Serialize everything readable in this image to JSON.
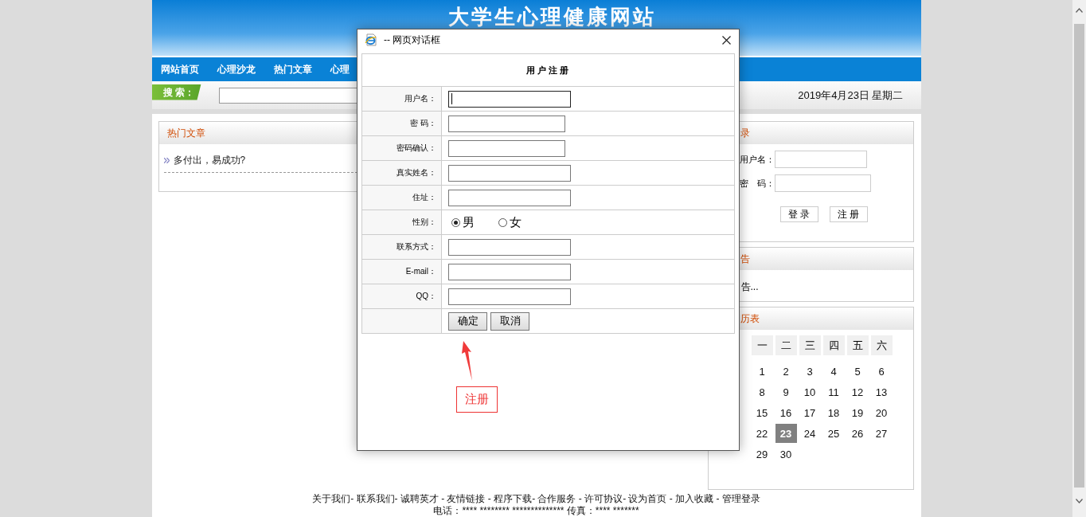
{
  "banner": {
    "title": "大学生心理健康网站"
  },
  "nav": [
    "网站首页",
    "心理沙龙",
    "热门文章",
    "心理"
  ],
  "search": {
    "label": "搜 索："
  },
  "date": "2019年4月23日 星期二",
  "hot_articles": {
    "title": "热门文章",
    "items": [
      "多付出，易成功?"
    ]
  },
  "login": {
    "title": "录",
    "fields": [
      "用户名：",
      "密　码："
    ],
    "buttons": [
      "登 录",
      "注 册"
    ]
  },
  "notice": {
    "title": "告",
    "text": "告..."
  },
  "calendar": {
    "title": "历表",
    "weekdays": [
      "一",
      "二",
      "三",
      "四",
      "五",
      "六"
    ],
    "weeks": [
      [
        {
          "day": "1",
          "selected": false
        },
        {
          "day": "2",
          "selected": false
        },
        {
          "day": "3",
          "selected": false
        },
        {
          "day": "4",
          "selected": false
        },
        {
          "day": "5",
          "selected": false
        },
        {
          "day": "6",
          "selected": false
        }
      ],
      [
        {
          "day": "8",
          "selected": false
        },
        {
          "day": "9",
          "selected": false
        },
        {
          "day": "10",
          "selected": false
        },
        {
          "day": "11",
          "selected": false
        },
        {
          "day": "12",
          "selected": false
        },
        {
          "day": "13",
          "selected": false
        }
      ],
      [
        {
          "day": "15",
          "selected": false
        },
        {
          "day": "16",
          "selected": false
        },
        {
          "day": "17",
          "selected": false
        },
        {
          "day": "18",
          "selected": false
        },
        {
          "day": "19",
          "selected": false
        },
        {
          "day": "20",
          "selected": false
        }
      ],
      [
        {
          "day": "22",
          "selected": false
        },
        {
          "day": "23",
          "selected": true
        },
        {
          "day": "24",
          "selected": false
        },
        {
          "day": "25",
          "selected": false
        },
        {
          "day": "26",
          "selected": false
        },
        {
          "day": "27",
          "selected": false
        }
      ],
      [
        {
          "day": "29",
          "selected": false
        },
        {
          "day": "30",
          "selected": false
        }
      ]
    ]
  },
  "footer": {
    "links": "关于我们- 联系我们- 诚聘英才 - 友情链接 - 程序下载- 合作服务 - 许可协议- 设为首页 - 加入收藏 - 管理登录",
    "contact": "电话：**** ******** ************** 传真：**** *******"
  },
  "dialog": {
    "title": "-- 网页对话框",
    "heading": "用户注册",
    "rows": [
      {
        "kind": "text",
        "label": "用户名：",
        "focused": true
      },
      {
        "kind": "password",
        "label": "密 码：",
        "focused": false
      },
      {
        "kind": "password",
        "label": "密码确认：",
        "focused": false
      },
      {
        "kind": "text",
        "label": "真实姓名：",
        "focused": false
      },
      {
        "kind": "text",
        "label": "住址：",
        "focused": false
      },
      {
        "kind": "radio",
        "label": "性别：",
        "options": [
          {
            "label": "男",
            "selected": true
          },
          {
            "label": "女",
            "selected": false
          }
        ]
      },
      {
        "kind": "text",
        "label": "联系方式：",
        "focused": false
      },
      {
        "kind": "text",
        "label": "E-mail：",
        "focused": false
      },
      {
        "kind": "text",
        "label": "QQ：",
        "focused": false
      }
    ],
    "buttons": [
      "确定",
      "取消"
    ]
  },
  "annotation": {
    "label": "注册"
  }
}
